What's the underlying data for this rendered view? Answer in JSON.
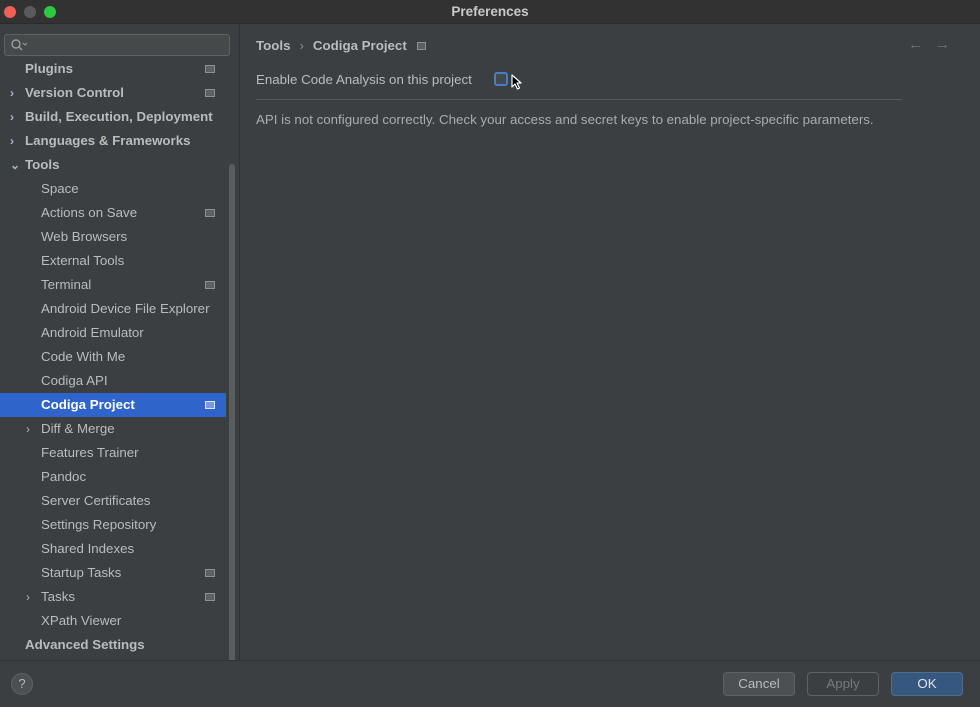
{
  "window": {
    "title": "Preferences"
  },
  "sidebar": {
    "search_placeholder": "",
    "items": [
      {
        "label": "Plugins",
        "indent": 0,
        "bold": true,
        "arrow": "",
        "proj": true
      },
      {
        "label": "Version Control",
        "indent": 0,
        "bold": true,
        "arrow": "›",
        "proj": true
      },
      {
        "label": "Build, Execution, Deployment",
        "indent": 0,
        "bold": true,
        "arrow": "›",
        "proj": false
      },
      {
        "label": "Languages & Frameworks",
        "indent": 0,
        "bold": true,
        "arrow": "›",
        "proj": false
      },
      {
        "label": "Tools",
        "indent": 0,
        "bold": true,
        "arrow": "⌄",
        "proj": false
      },
      {
        "label": "Space",
        "indent": 1,
        "bold": false,
        "arrow": "",
        "proj": false
      },
      {
        "label": "Actions on Save",
        "indent": 1,
        "bold": false,
        "arrow": "",
        "proj": true
      },
      {
        "label": "Web Browsers",
        "indent": 1,
        "bold": false,
        "arrow": "",
        "proj": false
      },
      {
        "label": "External Tools",
        "indent": 1,
        "bold": false,
        "arrow": "",
        "proj": false
      },
      {
        "label": "Terminal",
        "indent": 1,
        "bold": false,
        "arrow": "",
        "proj": true
      },
      {
        "label": "Android Device File Explorer",
        "indent": 1,
        "bold": false,
        "arrow": "",
        "proj": false
      },
      {
        "label": "Android Emulator",
        "indent": 1,
        "bold": false,
        "arrow": "",
        "proj": false
      },
      {
        "label": "Code With Me",
        "indent": 1,
        "bold": false,
        "arrow": "",
        "proj": false
      },
      {
        "label": "Codiga API",
        "indent": 1,
        "bold": false,
        "arrow": "",
        "proj": false
      },
      {
        "label": "Codiga Project",
        "indent": 1,
        "bold": true,
        "arrow": "",
        "proj": true,
        "selected": true
      },
      {
        "label": "Diff & Merge",
        "indent": 1,
        "bold": false,
        "arrow": "›",
        "proj": false
      },
      {
        "label": "Features Trainer",
        "indent": 1,
        "bold": false,
        "arrow": "",
        "proj": false
      },
      {
        "label": "Pandoc",
        "indent": 1,
        "bold": false,
        "arrow": "",
        "proj": false
      },
      {
        "label": "Server Certificates",
        "indent": 1,
        "bold": false,
        "arrow": "",
        "proj": false
      },
      {
        "label": "Settings Repository",
        "indent": 1,
        "bold": false,
        "arrow": "",
        "proj": false
      },
      {
        "label": "Shared Indexes",
        "indent": 1,
        "bold": false,
        "arrow": "",
        "proj": false
      },
      {
        "label": "Startup Tasks",
        "indent": 1,
        "bold": false,
        "arrow": "",
        "proj": true
      },
      {
        "label": "Tasks",
        "indent": 1,
        "bold": false,
        "arrow": "›",
        "proj": true
      },
      {
        "label": "XPath Viewer",
        "indent": 1,
        "bold": false,
        "arrow": "",
        "proj": false
      },
      {
        "label": "Advanced Settings",
        "indent": 0,
        "bold": true,
        "arrow": "",
        "proj": false
      }
    ]
  },
  "main": {
    "breadcrumb": {
      "parent": "Tools",
      "separator": "›",
      "current": "Codiga Project"
    },
    "nav": {
      "back": "←",
      "forward": "→"
    },
    "enable_label": "Enable Code Analysis on this project",
    "enable_checked": false,
    "message": "API is not configured correctly. Check your access and secret keys to enable project-specific parameters."
  },
  "footer": {
    "help": "?",
    "cancel": "Cancel",
    "apply": "Apply",
    "ok": "OK"
  },
  "colors": {
    "selection": "#2f65ca",
    "ok_button": "#365880",
    "checkbox_border": "#4a7ec4"
  }
}
